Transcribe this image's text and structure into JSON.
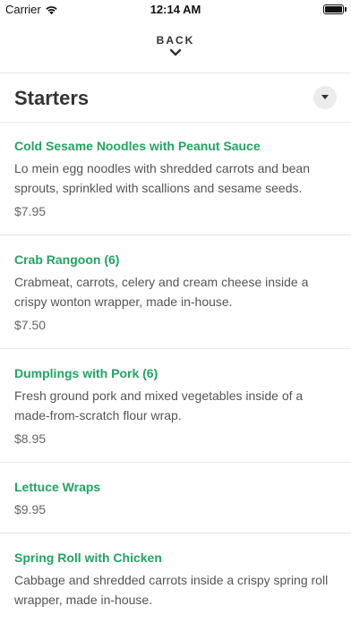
{
  "status_bar": {
    "carrier": "Carrier",
    "time": "12:14 AM"
  },
  "nav": {
    "back_label": "BACK"
  },
  "section": {
    "title": "Starters"
  },
  "items": [
    {
      "name": "Cold Sesame Noodles with Peanut Sauce",
      "description": "Lo mein egg noodles with shredded carrots and bean sprouts, sprinkled with scallions and sesame seeds.",
      "price": "$7.95"
    },
    {
      "name": "Crab Rangoon (6)",
      "description": "Crabmeat, carrots, celery and cream cheese inside a crispy wonton wrapper, made in-house.",
      "price": "$7.50"
    },
    {
      "name": "Dumplings with Pork (6)",
      "description": "Fresh ground pork and mixed vegetables inside of a made-from-scratch flour wrap.",
      "price": "$8.95"
    },
    {
      "name": "Lettuce Wraps",
      "description": "",
      "price": "$9.95"
    },
    {
      "name": "Spring Roll with Chicken",
      "description": "Cabbage and shredded carrots inside a crispy spring roll wrapper, made in-house.",
      "price": ""
    }
  ],
  "colors": {
    "accent": "#22a463",
    "divider": "#e6e6e6"
  }
}
